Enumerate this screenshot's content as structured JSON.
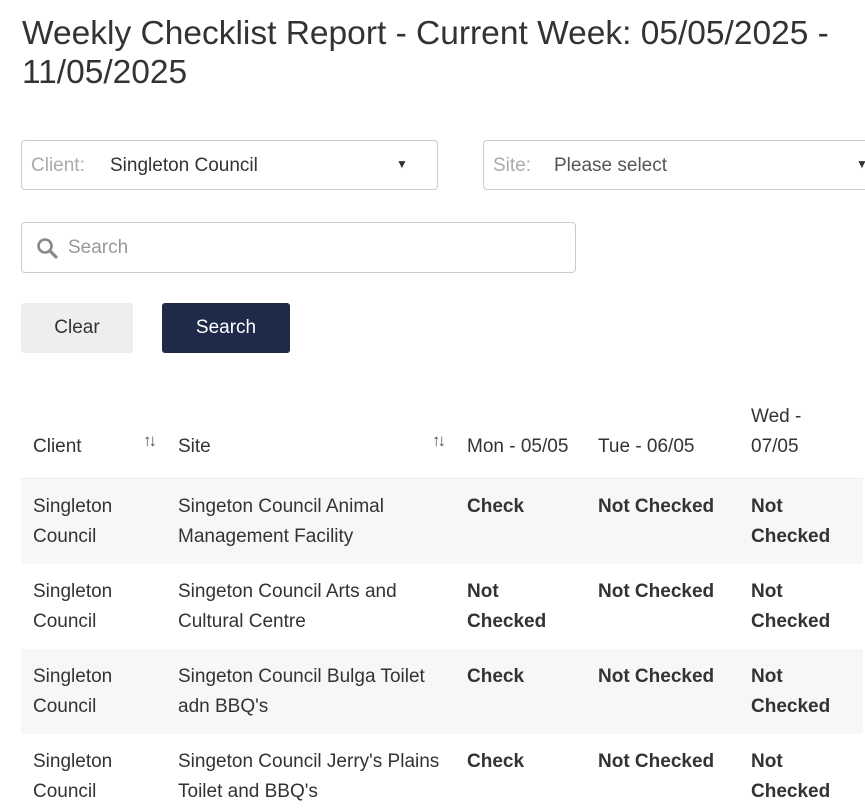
{
  "page": {
    "title": "Weekly Checklist Report - Current Week: 05/05/2025 - 11/05/2025"
  },
  "filters": {
    "client_label": "Client:",
    "client_value": "Singleton Council",
    "site_label": "Site:",
    "site_value": "Please select",
    "search_placeholder": "Search"
  },
  "buttons": {
    "clear": "Clear",
    "search": "Search"
  },
  "table": {
    "headers": {
      "client": "Client",
      "site": "Site",
      "mon": "Mon - 05/05",
      "tue": "Tue - 06/05",
      "wed": "Wed - 07/05"
    },
    "rows": [
      {
        "client": "Singleton Council",
        "site": "Singeton Council Animal Management Facility",
        "mon": "Check",
        "tue": "Not Checked",
        "wed": "Not Checked"
      },
      {
        "client": "Singleton Council",
        "site": "Singeton Council Arts and Cultural Centre",
        "mon": "Not Checked",
        "tue": "Not Checked",
        "wed": "Not Checked"
      },
      {
        "client": "Singleton Council",
        "site": "Singeton Council Bulga Toilet adn BBQ's",
        "mon": "Check",
        "tue": "Not Checked",
        "wed": "Not Checked"
      },
      {
        "client": "Singleton Council",
        "site": "Singeton Council Jerry's Plains Toilet and BBQ's",
        "mon": "Check",
        "tue": "Not Checked",
        "wed": "Not Checked"
      }
    ]
  },
  "colors": {
    "check": "#3c8a1e",
    "not_checked": "#e21b1b",
    "primary_button": "#1f2a4a"
  }
}
